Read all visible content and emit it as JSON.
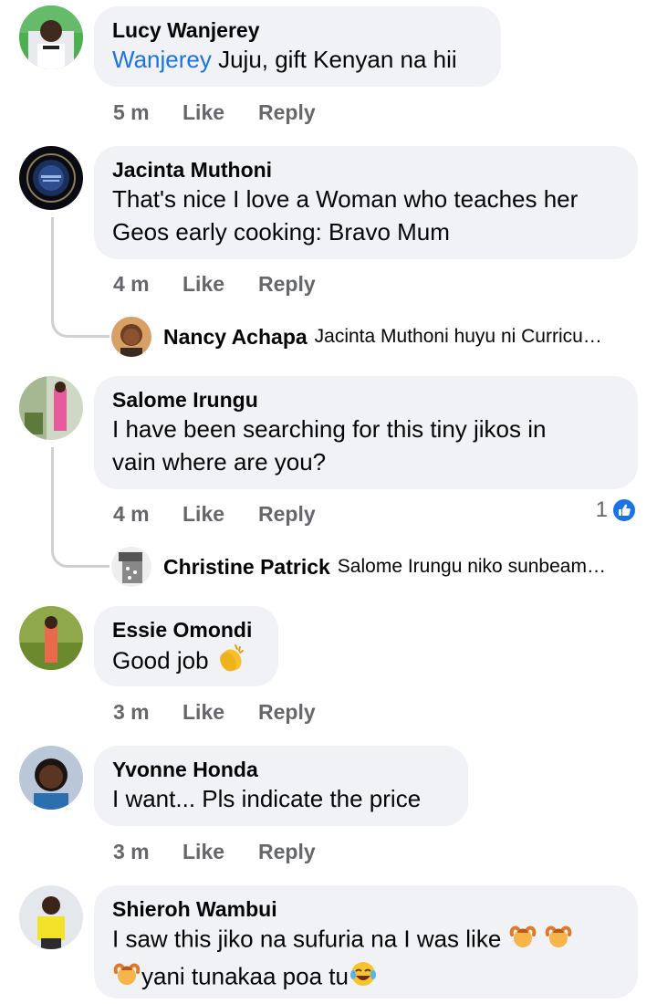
{
  "comments": [
    {
      "author": "Lucy Wanjerey",
      "mention": "Wanjerey",
      "text": " Juju, gift Kenyan na hii",
      "time": "5 m",
      "like": "Like",
      "reply": "Reply"
    },
    {
      "author": "Jacinta Muthoni",
      "line1": "That's nice I love a Woman who teaches her",
      "line2": "Geos early cooking: Bravo Mum",
      "time": "4 m",
      "like": "Like",
      "reply": "Reply",
      "reply_preview": {
        "author": "Nancy Achapa",
        "text": "Jacinta Muthoni huyu ni Curricu…"
      }
    },
    {
      "author": "Salome Irungu",
      "line1": "I have been searching for this tiny jikos in",
      "line2": "vain where are you?",
      "time": "4 m",
      "like": "Like",
      "reply": "Reply",
      "reaction_count": "1",
      "reply_preview": {
        "author": "Christine Patrick",
        "text": "Salome Irungu niko sunbeam…"
      }
    },
    {
      "author": "Essie Omondi",
      "text": "Good job",
      "emoji": "clapping-hands",
      "time": "3 m",
      "like": "Like",
      "reply": "Reply"
    },
    {
      "author": "Yvonne Honda",
      "text": "I want... Pls indicate the price",
      "time": "3 m",
      "like": "Like",
      "reply": "Reply"
    },
    {
      "author": "Shieroh Wambui",
      "line1": "I saw this jiko na sufuria na I was like",
      "line2": "yani tunakaa poa tu",
      "emoji1": "person-gesturing-ok",
      "emoji2": "face-with-tears-of-joy"
    }
  ],
  "colors": {
    "bubble": "#f0f2f5",
    "mention": "#1b74e4",
    "meta": "#65676b",
    "like_badge": "#1b74e4"
  }
}
